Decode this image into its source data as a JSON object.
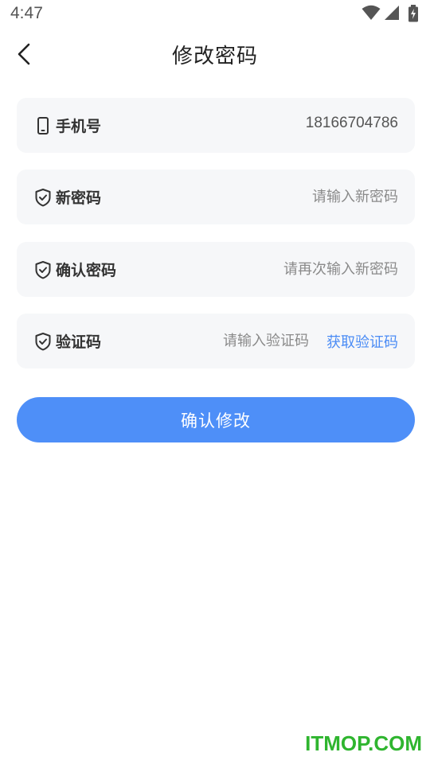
{
  "status_bar": {
    "time": "4:47"
  },
  "header": {
    "title": "修改密码"
  },
  "form": {
    "phone": {
      "label": "手机号",
      "value": "18166704786"
    },
    "new_password": {
      "label": "新密码",
      "placeholder": "请输入新密码"
    },
    "confirm_password": {
      "label": "确认密码",
      "placeholder": "请再次输入新密码"
    },
    "verification_code": {
      "label": "验证码",
      "placeholder": "请输入验证码",
      "get_code_label": "获取验证码"
    }
  },
  "confirm_button": {
    "label": "确认修改"
  },
  "watermark": "ITMOP.COM",
  "colors": {
    "primary": "#4e8ff8",
    "link": "#4b8cf5",
    "field_bg": "#f6f7f9",
    "watermark": "#2fb52f"
  },
  "icons": {
    "phone_field": "phone-icon",
    "password_fields": "shield-check-icon",
    "back": "chevron-left-icon"
  }
}
